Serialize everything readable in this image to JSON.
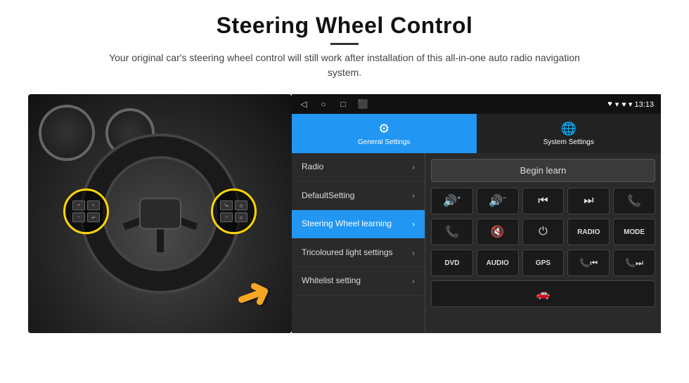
{
  "header": {
    "title": "Steering Wheel Control",
    "subtitle": "Your original car's steering wheel control will still work after installation of this all-in-one auto radio navigation system."
  },
  "statusBar": {
    "navIcons": [
      "◁",
      "○",
      "□",
      "⬛"
    ],
    "rightIcons": "♥ ▾ 13:13"
  },
  "tabs": [
    {
      "id": "general",
      "label": "General Settings",
      "active": true,
      "icon": "⚙"
    },
    {
      "id": "system",
      "label": "System Settings",
      "active": false,
      "icon": "🌐"
    }
  ],
  "menuItems": [
    {
      "label": "Radio",
      "active": false
    },
    {
      "label": "DefaultSetting",
      "active": false
    },
    {
      "label": "Steering Wheel learning",
      "active": true
    },
    {
      "label": "Tricoloured light settings",
      "active": false
    },
    {
      "label": "Whitelist setting",
      "active": false
    }
  ],
  "controls": {
    "beginLearnLabel": "Begin learn",
    "row1": [
      "🔊+",
      "🔊-",
      "⏮",
      "⏭",
      "📞"
    ],
    "row2": [
      "📞↩",
      "🔇",
      "⏻",
      "RADIO",
      "MODE"
    ],
    "row3Bottom": [
      "DVD",
      "AUDIO",
      "GPS",
      "📞⏮",
      "📞⏭"
    ],
    "lastRow": [
      "🚘"
    ]
  }
}
